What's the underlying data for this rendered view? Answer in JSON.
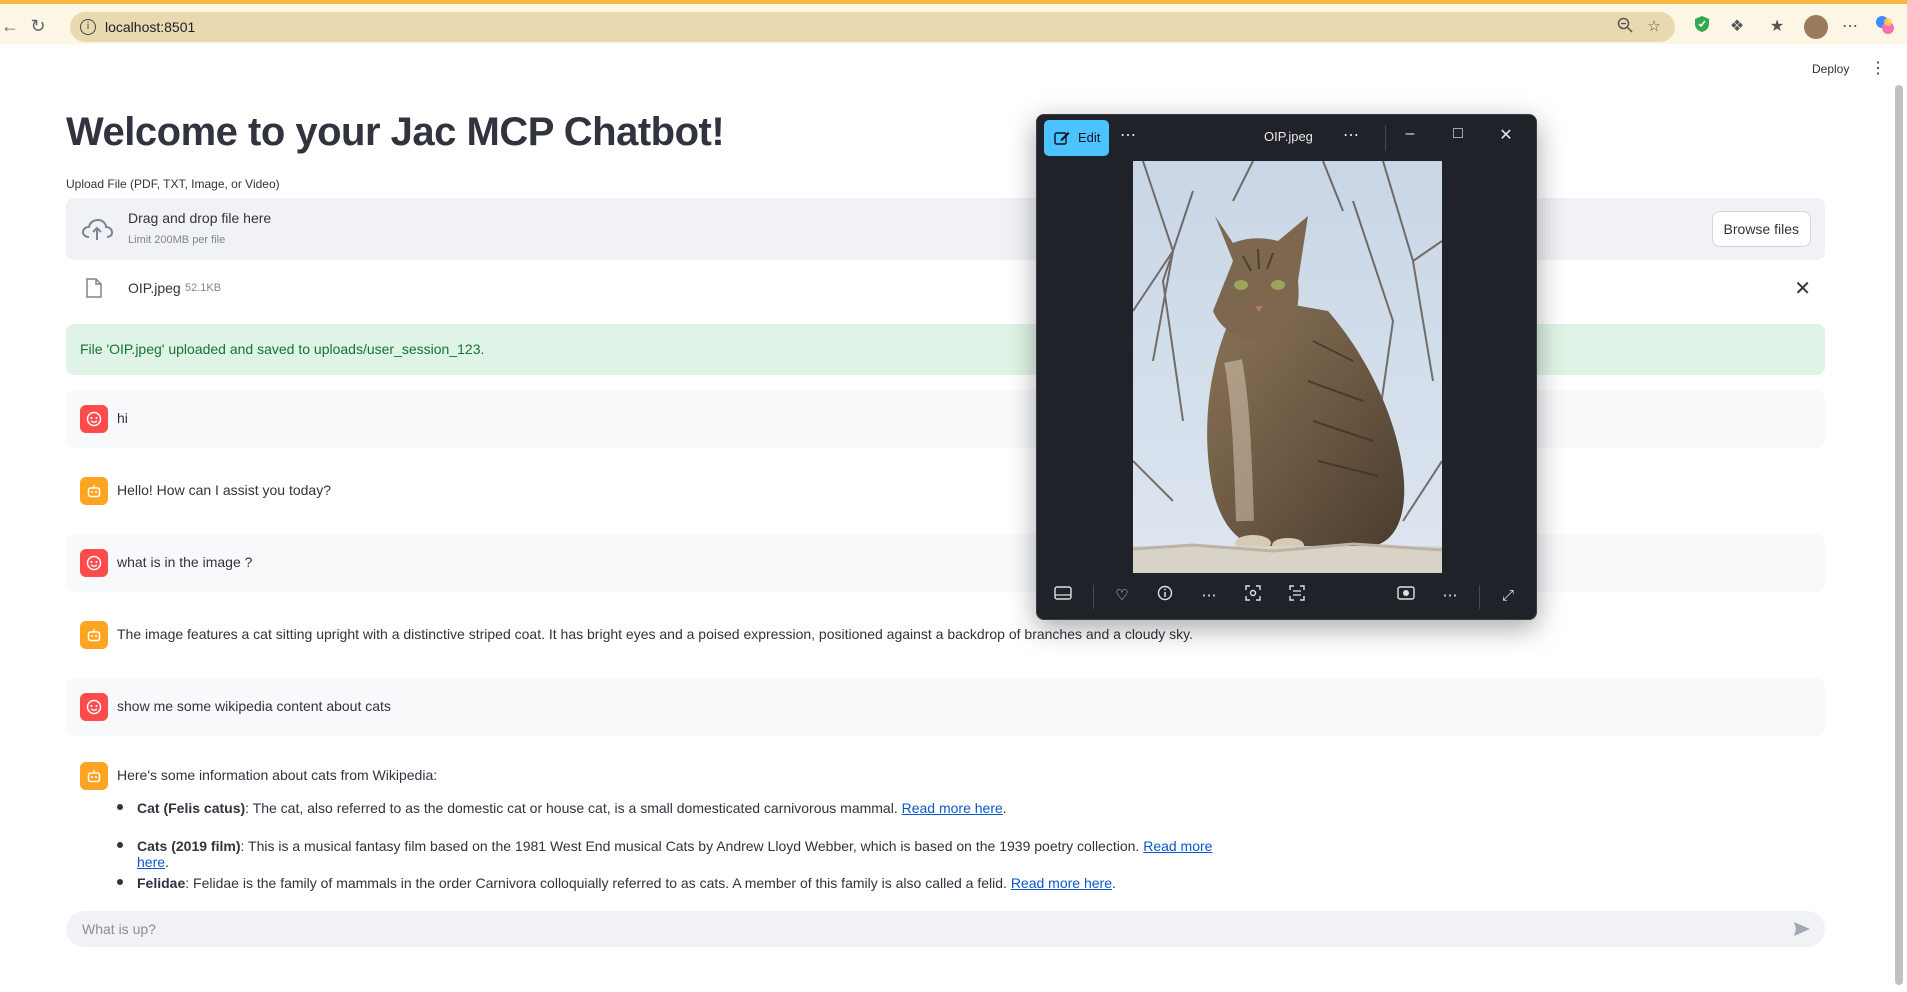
{
  "browser": {
    "url": "localhost:8501"
  },
  "app": {
    "deploy_label": "Deploy",
    "title": "Welcome to your Jac MCP Chatbot!",
    "upload_label": "Upload File (PDF, TXT, Image, or Video)",
    "dropzone": {
      "title": "Drag and drop file here",
      "limit": "Limit 200MB per file",
      "browse_label": "Browse files"
    },
    "file": {
      "name": "OIP.jpeg",
      "size": "52.1KB"
    },
    "success_message": "File 'OIP.jpeg' uploaded and saved to uploads/user_session_123.",
    "messages": [
      {
        "role": "user",
        "text": "hi"
      },
      {
        "role": "assistant",
        "text": "Hello! How can I assist you today?"
      },
      {
        "role": "user",
        "text": "what is in the image ?"
      },
      {
        "role": "assistant",
        "text": "The image features a cat sitting upright with a distinctive striped coat. It has bright eyes and a poised expression, positioned against a backdrop of branches and a cloudy sky."
      },
      {
        "role": "user",
        "text": "show me some wikipedia content about cats"
      },
      {
        "role": "assistant",
        "text": "Here's some information about cats from Wikipedia:"
      }
    ],
    "wiki_items": [
      {
        "term": "Cat (Felis catus)",
        "text": ": The cat, also referred to as the domestic cat or house cat, is a small domesticated carnivorous mammal. ",
        "link": "Read more here",
        "end": "."
      },
      {
        "term": "Cats (2019 film)",
        "text": ": This is a musical fantasy film based on the 1981 West End musical Cats by Andrew Lloyd Webber, which is based on the 1939 poetry collection. ",
        "link": "Read more here",
        "end": "."
      },
      {
        "term": "Felidae",
        "text": ": Felidae is the family of mammals in the order Carnivora colloquially referred to as cats. A member of this family is also called a felid. ",
        "link": "Read more here",
        "end": "."
      }
    ],
    "chat_placeholder": "What is up?"
  },
  "viewer": {
    "edit_label": "Edit",
    "title": "OIP.jpeg"
  },
  "colors": {
    "user_avatar": "#ff4b4b",
    "assistant_avatar": "#ffa421",
    "success_bg": "#dff4e6",
    "edit_button": "#4cc2ff"
  }
}
